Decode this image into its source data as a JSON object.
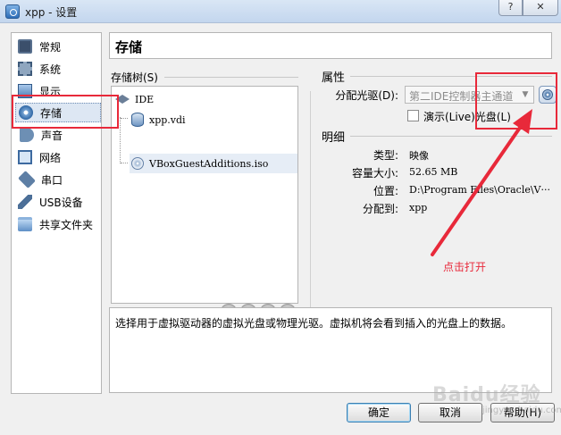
{
  "window": {
    "title": "xpp - 设置",
    "help_label": "?",
    "close_label": "✕"
  },
  "sidebar": {
    "items": [
      {
        "label": "常规",
        "icon": "general-icon"
      },
      {
        "label": "系统",
        "icon": "system-icon"
      },
      {
        "label": "显示",
        "icon": "display-icon"
      },
      {
        "label": "存储",
        "icon": "storage-icon",
        "selected": true
      },
      {
        "label": "声音",
        "icon": "audio-icon"
      },
      {
        "label": "网络",
        "icon": "network-icon"
      },
      {
        "label": "串口",
        "icon": "serial-port-icon"
      },
      {
        "label": "USB设备",
        "icon": "usb-icon"
      },
      {
        "label": "共享文件夹",
        "icon": "shared-folder-icon"
      }
    ]
  },
  "page": {
    "title": "存储"
  },
  "storage_tree": {
    "label": "存储树(S)",
    "controller": "IDE",
    "attachments": [
      "xpp.vdi",
      "VBoxGuestAdditions.iso"
    ]
  },
  "attributes": {
    "title": "属性",
    "drive_label": "分配光驱(D):",
    "drive_value": "第二IDE控制器主通道",
    "live_cd_label": "演示(Live)光盘(L)"
  },
  "details": {
    "title": "明细",
    "rows": [
      {
        "label": "类型:",
        "value": "映像"
      },
      {
        "label": "容量大小:",
        "value": "52.65  MB"
      },
      {
        "label": "位置:",
        "value": "D:\\Program  Files\\Oracle\\V···"
      },
      {
        "label": "分配到:",
        "value": "xpp"
      }
    ]
  },
  "hint": "选择用于虚拟驱动器的虚拟光盘或物理光驱。虚拟机将会看到插入的光盘上的数据。",
  "buttons": {
    "ok": "确定",
    "cancel": "取消",
    "help": "帮助(H)"
  },
  "annotation": {
    "text": "点击打开",
    "color": "#e8293a"
  },
  "watermark": {
    "text": "Baidu经验",
    "sub": "jingyan.baidu.com"
  }
}
